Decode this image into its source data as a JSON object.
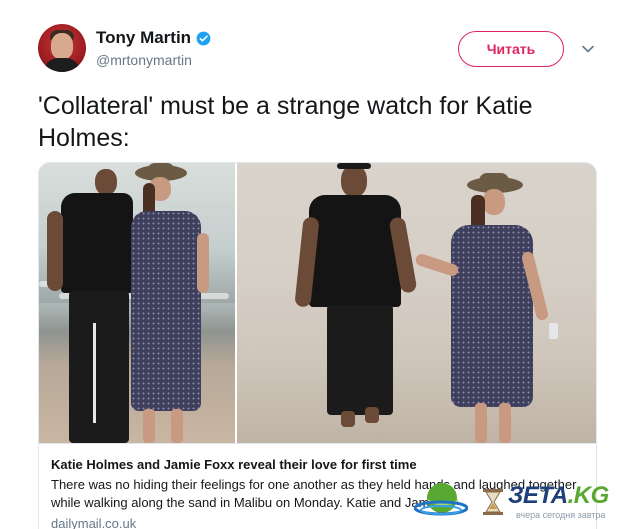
{
  "author": {
    "display_name": "Tony Martin",
    "handle": "@mrtonymartin",
    "verified": true,
    "avatar_icon": "profile-photo"
  },
  "follow_button": {
    "label": "Читать",
    "color": "#e0245e"
  },
  "menu_icon": "chevron-down-icon",
  "tweet": {
    "text": "'Collateral' must be a strange watch for Katie Holmes:"
  },
  "card": {
    "title": "Katie Holmes and Jamie Foxx reveal their love for first time",
    "description": "There was no hiding their feelings for one another as they held hands and laughed together while walking along the sand in Malibu on Monday. Katie and Jamie...",
    "domain": "dailymail.co.uk"
  },
  "watermark": {
    "brand_main": "ЗETA",
    "brand_tld": ".KG",
    "tagline": "вчера сегодня завтра"
  },
  "colors": {
    "accent": "#e0245e",
    "verified_blue": "#1da1f2",
    "secondary_text": "#657786",
    "border": "#e1e8ed"
  }
}
